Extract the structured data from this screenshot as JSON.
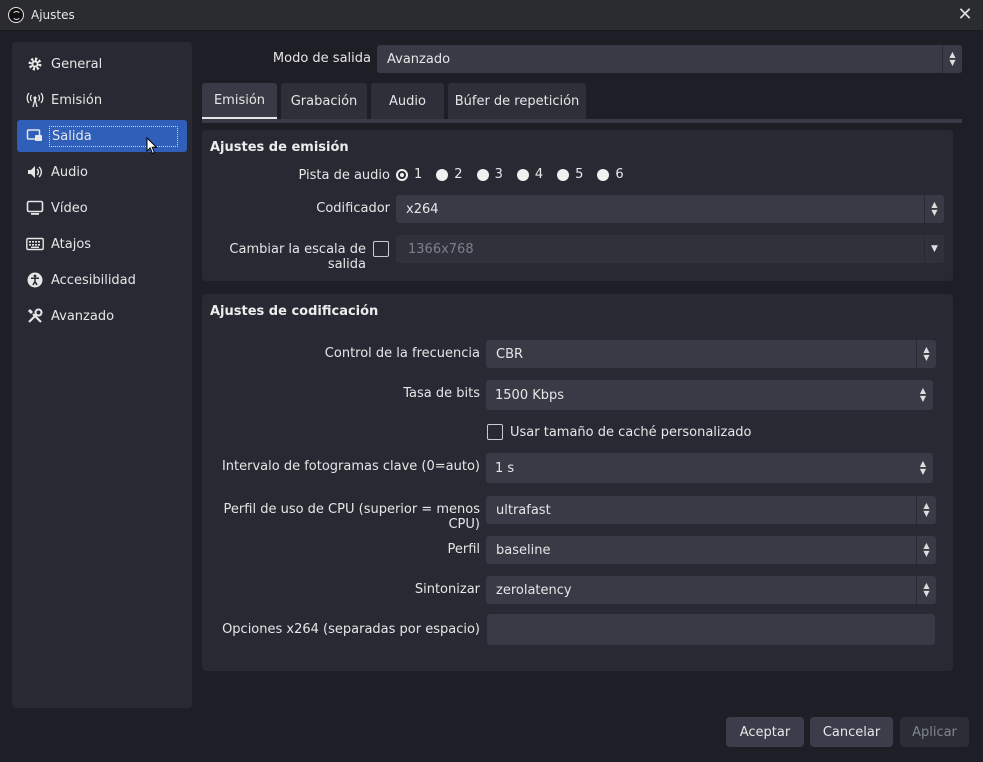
{
  "window": {
    "title": "Ajustes"
  },
  "sidebar": {
    "items": [
      {
        "label": "General",
        "icon": "gear-icon"
      },
      {
        "label": "Emisión",
        "icon": "broadcast-icon"
      },
      {
        "label": "Salida",
        "icon": "output-icon"
      },
      {
        "label": "Audio",
        "icon": "speaker-icon"
      },
      {
        "label": "Vídeo",
        "icon": "monitor-icon"
      },
      {
        "label": "Atajos",
        "icon": "keyboard-icon"
      },
      {
        "label": "Accesibilidad",
        "icon": "accessibility-icon"
      },
      {
        "label": "Avanzado",
        "icon": "tools-icon"
      }
    ],
    "selected": "Salida"
  },
  "output_mode": {
    "label": "Modo de salida",
    "value": "Avanzado"
  },
  "tabs": [
    "Emisión",
    "Grabación",
    "Audio",
    "Búfer de repetición"
  ],
  "stream_settings": {
    "title": "Ajustes de emisión",
    "audio_track_label": "Pista de audio",
    "audio_tracks": [
      "1",
      "2",
      "3",
      "4",
      "5",
      "6"
    ],
    "encoder_label": "Codificador",
    "encoder_value": "x264",
    "rescale_label": "Cambiar la escala de salida",
    "rescale_value": "1366x768"
  },
  "encoding_settings": {
    "title": "Ajustes de codificación",
    "rate_control_label": "Control de la frecuencia",
    "rate_control_value": "CBR",
    "bitrate_label": "Tasa de bits",
    "bitrate_value": "1500 Kbps",
    "custom_buffer_label": "Usar tamaño de caché personalizado",
    "keyframe_label": "Intervalo de fotogramas clave (0=auto)",
    "keyframe_value": "1 s",
    "cpu_preset_label": "Perfil de uso de CPU (superior = menos CPU)",
    "cpu_preset_value": "ultrafast",
    "profile_label": "Perfil",
    "profile_value": "baseline",
    "tune_label": "Sintonizar",
    "tune_value": "zerolatency",
    "x264_options_label": "Opciones x264 (separadas por espacio)",
    "x264_options_value": ""
  },
  "buttons": {
    "ok": "Aceptar",
    "cancel": "Cancelar",
    "apply": "Aplicar"
  }
}
